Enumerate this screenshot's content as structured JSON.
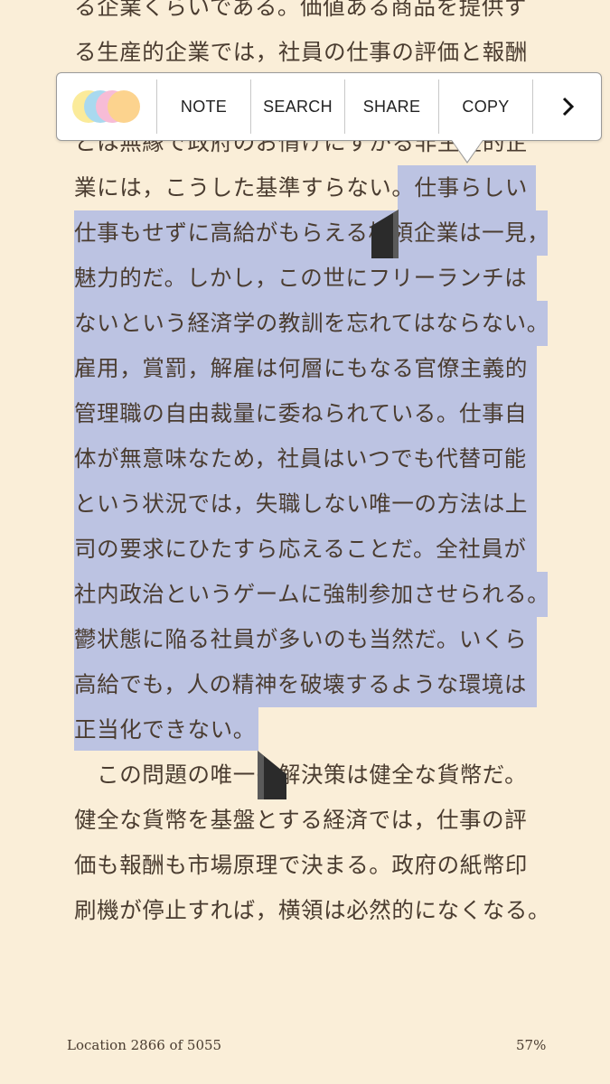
{
  "toolbar": {
    "note": "NOTE",
    "search": "SEARCH",
    "share": "SHARE",
    "copy": "COPY",
    "more_icon": "chevron-right-icon",
    "swatch_colors": [
      "#fbeb9a",
      "#a9d9ef",
      "#f7bcd6",
      "#fcd38e"
    ]
  },
  "text": {
    "lines": [
      "る企業くらいである。価値ある商品を提供す",
      "る生産的企業では，社員の仕事の評価と報酬",
      "とは無縁で政府のお情けにすがる非生産的企",
      "業には，こうした基準すらない。",
      "仕事らしい",
      "仕事もせずに高給がもらえる横領企業は一見，",
      "魅力的だ。しかし，この世にフリーランチは",
      "ないという経済学の教訓を忘れてはならない。",
      "雇用，賞罰，解雇は何層にもなる官僚主義的",
      "管理職の自由裁量に委ねられている。仕事自",
      "体が無意味なため，社員はいつでも代替可能",
      "という状況では，失職しない唯一の方法は上",
      "司の要求にひたすら応えることだ。全社員が",
      "社内政治というゲームに強制参加させられる。",
      "鬱状態に陥る社員が多いのも当然だ。いくら",
      "高給でも，人の精神を破壊するような環境は",
      "正当化できない。",
      "　この問題の唯一の解決策は健全な貨幣だ。",
      "健全な貨幣を基盤とする経済では，仕事の評",
      "価も報酬も市場原理で決まる。政府の紙幣印",
      "刷機が停止すれば，横領は必然的になくなる。"
    ]
  },
  "footer": {
    "location": "Location 2866 of 5055",
    "percent": "57%"
  },
  "colors": {
    "background": "#faeed8",
    "highlight": "#bcc3e2",
    "text": "#4a3c30"
  }
}
